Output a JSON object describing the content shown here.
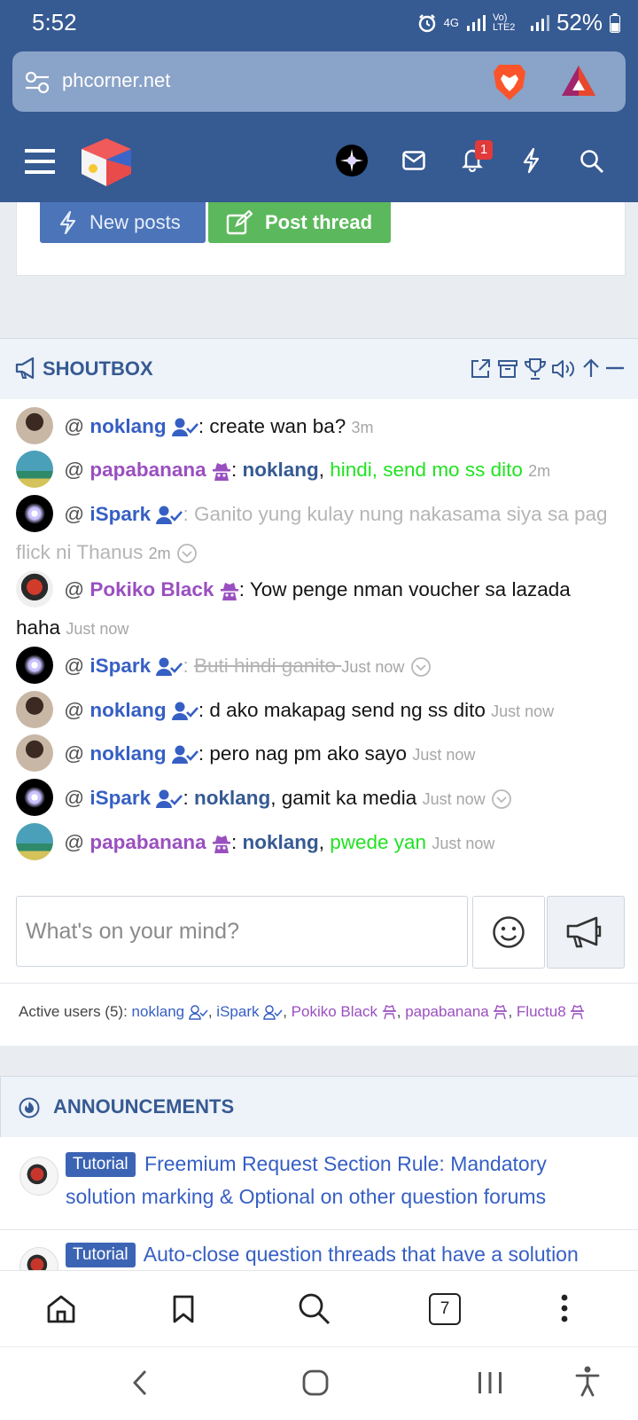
{
  "status_bar": {
    "time": "5:52",
    "network": "4G",
    "network2": "Vo) LTE2",
    "battery": "52%"
  },
  "browser": {
    "url": "phcorner.net",
    "tabs_count": "7"
  },
  "site_nav": {
    "notification_count": "1"
  },
  "buttons": {
    "new_posts": "New posts",
    "post_thread": "Post thread"
  },
  "shoutbox": {
    "title": "SHOUTBOX",
    "messages": [
      {
        "at": "@",
        "user": "noklang",
        "sep": ": ",
        "text": "create wan ba?",
        "time": "3m"
      },
      {
        "at": "@",
        "user": "papabanana",
        "sep": ": ",
        "mention": "noklang",
        "comma": ", ",
        "text": "hindi, send mo ss dito",
        "time": "2m"
      },
      {
        "at": "@",
        "user": "iSpark",
        "sep": ": ",
        "text": "Ganito yung kulay nung nakasama siya sa pag flick ni Thanus",
        "time": "2m"
      },
      {
        "at": "@",
        "user": "Pokiko Black",
        "sep": ": ",
        "text": "Yow penge nman voucher sa lazada haha",
        "time": "Just now"
      },
      {
        "at": "@",
        "user": "iSpark",
        "sep": ": ",
        "text": "Buti hindi ganito ",
        "time": "Just now"
      },
      {
        "at": "@",
        "user": "noklang",
        "sep": ": ",
        "text": "d ako makapag send ng ss dito",
        "time": "Just now"
      },
      {
        "at": "@",
        "user": "noklang",
        "sep": ": ",
        "text": "pero nag pm ako sayo",
        "time": "Just now"
      },
      {
        "at": "@",
        "user": "iSpark",
        "sep": ": ",
        "mention": "noklang",
        "comma": ", ",
        "text": "gamit ka media",
        "time": "Just now"
      },
      {
        "at": "@",
        "user": "papabanana",
        "sep": ": ",
        "mention": "noklang",
        "comma": ", ",
        "text": "pwede yan",
        "time": "Just now"
      }
    ],
    "input_placeholder": "What's on your mind?",
    "active_label": "Active users (5): ",
    "active_users": [
      "noklang",
      "iSpark",
      "Pokiko Black",
      "papabanana",
      "Fluctu8"
    ],
    "comma": ", "
  },
  "announcements": {
    "title": "ANNOUNCEMENTS",
    "items": [
      {
        "tag": "Tutorial",
        "title": "Freemium Request Section Rule: Mandatory solution marking & Optional on other question forums"
      },
      {
        "tag": "Tutorial",
        "title": "Auto-close question threads that have a solution"
      }
    ]
  },
  "colors": {
    "brand": "#365a92",
    "member_blue": "#365fc4",
    "member_purple": "#9a4fc0",
    "green_text": "#22e222",
    "post_thread_green": "#5cb85c"
  }
}
